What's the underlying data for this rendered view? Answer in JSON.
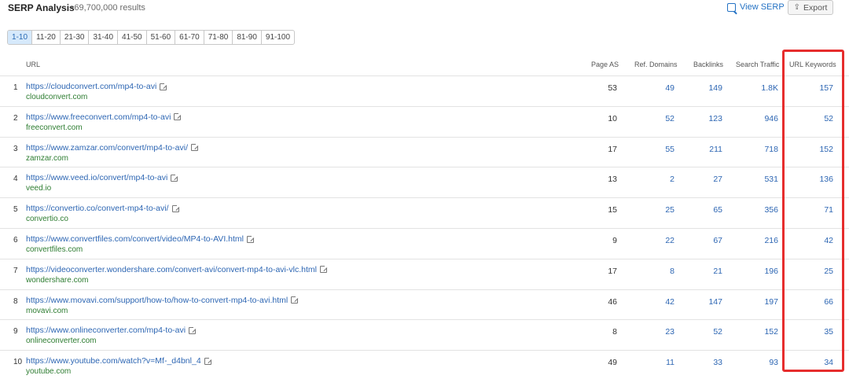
{
  "header": {
    "title": "SERP Analysis",
    "subtitle": "~69,700,000 results",
    "view_serp_label": "View SERP",
    "export_label": "Export"
  },
  "pagination": [
    "1-10",
    "11-20",
    "21-30",
    "31-40",
    "41-50",
    "51-60",
    "61-70",
    "71-80",
    "81-90",
    "91-100"
  ],
  "pagination_active": "1-10",
  "columns": {
    "url": "URL",
    "page_as": "Page AS",
    "ref_domains": "Ref. Domains",
    "backlinks": "Backlinks",
    "search_traffic": "Search Traffic",
    "url_keywords": "URL Keywords"
  },
  "rows": [
    {
      "num": "1",
      "url": "https://cloudconvert.com/mp4-to-avi",
      "domain": "cloudconvert.com",
      "page_as": "53",
      "ref_domains": "49",
      "backlinks": "149",
      "search_traffic": "1.8K",
      "url_keywords": "157"
    },
    {
      "num": "2",
      "url": "https://www.freeconvert.com/mp4-to-avi",
      "domain": "freeconvert.com",
      "page_as": "10",
      "ref_domains": "52",
      "backlinks": "123",
      "search_traffic": "946",
      "url_keywords": "52"
    },
    {
      "num": "3",
      "url": "https://www.zamzar.com/convert/mp4-to-avi/",
      "domain": "zamzar.com",
      "page_as": "17",
      "ref_domains": "55",
      "backlinks": "211",
      "search_traffic": "718",
      "url_keywords": "152"
    },
    {
      "num": "4",
      "url": "https://www.veed.io/convert/mp4-to-avi",
      "domain": "veed.io",
      "page_as": "13",
      "ref_domains": "2",
      "backlinks": "27",
      "search_traffic": "531",
      "url_keywords": "136"
    },
    {
      "num": "5",
      "url": "https://convertio.co/convert-mp4-to-avi/",
      "domain": "convertio.co",
      "page_as": "15",
      "ref_domains": "25",
      "backlinks": "65",
      "search_traffic": "356",
      "url_keywords": "71"
    },
    {
      "num": "6",
      "url": "https://www.convertfiles.com/convert/video/MP4-to-AVI.html",
      "domain": "convertfiles.com",
      "page_as": "9",
      "ref_domains": "22",
      "backlinks": "67",
      "search_traffic": "216",
      "url_keywords": "42"
    },
    {
      "num": "7",
      "url": "https://videoconverter.wondershare.com/convert-avi/convert-mp4-to-avi-vlc.html",
      "domain": "wondershare.com",
      "page_as": "17",
      "ref_domains": "8",
      "backlinks": "21",
      "search_traffic": "196",
      "url_keywords": "25"
    },
    {
      "num": "8",
      "url": "https://www.movavi.com/support/how-to/how-to-convert-mp4-to-avi.html",
      "domain": "movavi.com",
      "page_as": "46",
      "ref_domains": "42",
      "backlinks": "147",
      "search_traffic": "197",
      "url_keywords": "66"
    },
    {
      "num": "9",
      "url": "https://www.onlineconverter.com/mp4-to-avi",
      "domain": "onlineconverter.com",
      "page_as": "8",
      "ref_domains": "23",
      "backlinks": "52",
      "search_traffic": "152",
      "url_keywords": "35"
    },
    {
      "num": "10",
      "url": "https://www.youtube.com/watch?v=Mf-_d4bnl_4",
      "domain": "youtube.com",
      "page_as": "49",
      "ref_domains": "11",
      "backlinks": "33",
      "search_traffic": "93",
      "url_keywords": "34"
    }
  ],
  "colors": {
    "link": "#2d66b3",
    "domain": "#2e7d32",
    "highlight": "#e62d2d",
    "active_page_bg": "#d6e9fb"
  }
}
